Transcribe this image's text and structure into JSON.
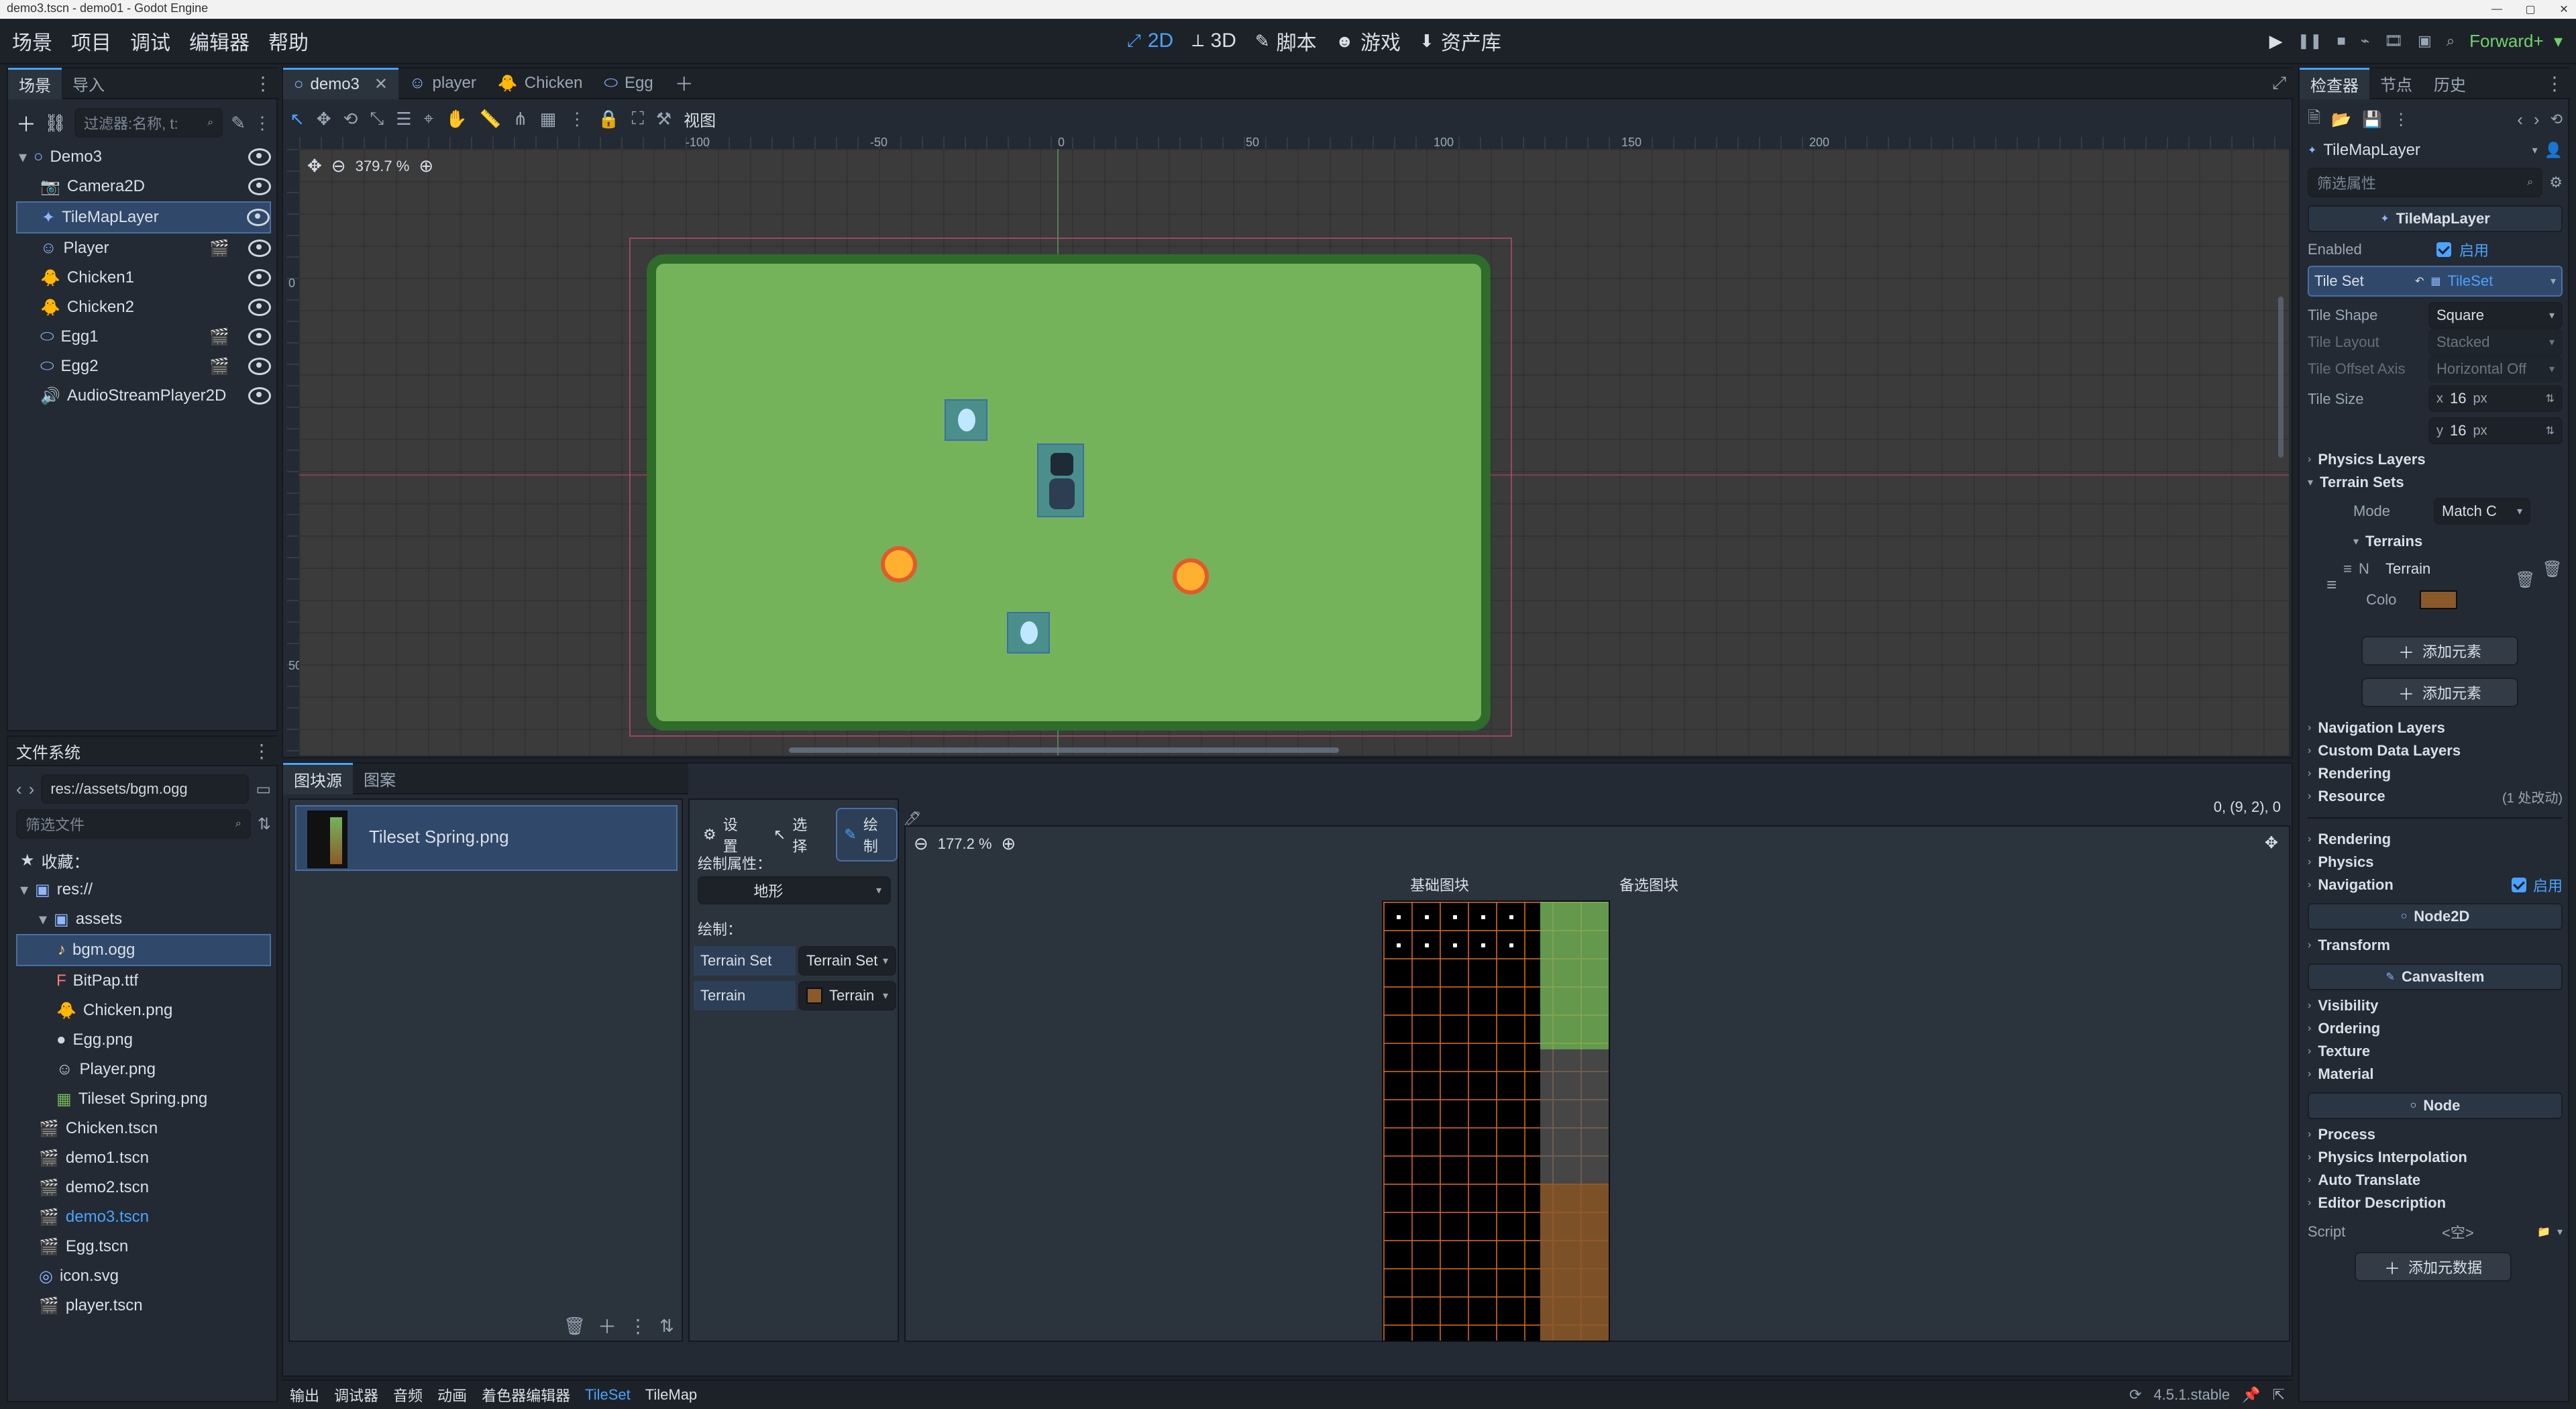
{
  "window": {
    "title": "demo3.tscn - demo01 - Godot Engine",
    "controls": [
      "minimize-icon",
      "maximize-icon",
      "close-icon"
    ]
  },
  "menubar": {
    "menus": [
      "场景",
      "项目",
      "调试",
      "编辑器",
      "帮助"
    ],
    "center_modes": [
      "2D",
      "3D",
      "脚本",
      "游戏",
      "资产库"
    ],
    "renderer_label": "Forward+"
  },
  "scene_dock": {
    "tabs": [
      "场景",
      "导入"
    ],
    "filter_placeholder": "过滤器:名称, t:",
    "nodes": [
      {
        "name": "Demo3",
        "indent": 0,
        "type_icon": "node2d-icon",
        "selected": false
      },
      {
        "name": "Camera2D",
        "indent": 1,
        "type_icon": "camera-icon",
        "selected": false
      },
      {
        "name": "TileMapLayer",
        "indent": 1,
        "type_icon": "tilemap-icon",
        "selected": true
      },
      {
        "name": "Player",
        "indent": 1,
        "type_icon": "player-icon",
        "selected": false
      },
      {
        "name": "Chicken1",
        "indent": 1,
        "type_icon": "chicken-icon",
        "selected": false
      },
      {
        "name": "Chicken2",
        "indent": 1,
        "type_icon": "chicken-icon",
        "selected": false
      },
      {
        "name": "Egg1",
        "indent": 1,
        "type_icon": "egg-icon",
        "selected": false
      },
      {
        "name": "Egg2",
        "indent": 1,
        "type_icon": "egg-icon",
        "selected": false
      },
      {
        "name": "AudioStreamPlayer2D",
        "indent": 1,
        "type_icon": "audio-icon",
        "selected": false
      }
    ]
  },
  "filesystem_dock": {
    "title": "文件系统",
    "path": "res://assets/bgm.ogg",
    "filter_placeholder": "筛选文件",
    "favorites_label": "收藏：",
    "items": [
      {
        "label": "res://",
        "indent": 0,
        "type": "folder"
      },
      {
        "label": "assets",
        "indent": 1,
        "type": "folder"
      },
      {
        "label": "bgm.ogg",
        "indent": 2,
        "type": "audio",
        "selected": true
      },
      {
        "label": "BitPap.ttf",
        "indent": 2,
        "type": "font"
      },
      {
        "label": "Chicken.png",
        "indent": 2,
        "type": "image"
      },
      {
        "label": "Egg.png",
        "indent": 2,
        "type": "image"
      },
      {
        "label": "Player.png",
        "indent": 2,
        "type": "image"
      },
      {
        "label": "Tileset Spring.png",
        "indent": 2,
        "type": "image"
      },
      {
        "label": "Chicken.tscn",
        "indent": 1,
        "type": "scene"
      },
      {
        "label": "demo1.tscn",
        "indent": 1,
        "type": "scene"
      },
      {
        "label": "demo2.tscn",
        "indent": 1,
        "type": "scene"
      },
      {
        "label": "demo3.tscn",
        "indent": 1,
        "type": "scene",
        "active": true
      },
      {
        "label": "Egg.tscn",
        "indent": 1,
        "type": "scene"
      },
      {
        "label": "icon.svg",
        "indent": 1,
        "type": "svg"
      },
      {
        "label": "player.tscn",
        "indent": 1,
        "type": "scene"
      }
    ]
  },
  "scene_tabs": {
    "tabs": [
      "demo3",
      "player",
      "Chicken",
      "Egg"
    ],
    "active_index": 0
  },
  "viewport": {
    "zoom_label": "379.7 %",
    "toolbar_view_label": "视图",
    "ruler_labels": [
      "-100",
      "-50",
      "0",
      "50",
      "100",
      "150",
      "200"
    ],
    "left_ruler_labels": [
      "0",
      "50"
    ]
  },
  "bottom_panel": {
    "tabs": [
      "图块源",
      "图案"
    ],
    "source_name": "Tileset Spring.png",
    "tools": [
      "设置",
      "选择",
      "绘制"
    ],
    "paint_props_label": "绘制属性：",
    "paint_mode_value": "地形",
    "paint_label": "绘制：",
    "terrain_set_label": "Terrain Set",
    "terrain_set_value": "Terrain Set",
    "terrain_label": "Terrain",
    "terrain_value": "Terrain",
    "atlas_zoom": "177.2 %",
    "atlas_headers": [
      "基础图块",
      "备选图块"
    ],
    "coords": "0, (9, 2), 0"
  },
  "bottom_tabs": {
    "items": [
      "输出",
      "调试器",
      "音频",
      "动画",
      "着色器编辑器",
      "TileSet",
      "TileMap"
    ],
    "active": "TileSet",
    "version": "4.5.1.stable"
  },
  "inspector": {
    "tabs": [
      "检查器",
      "节点",
      "历史"
    ],
    "object_name": "TileMapLayer",
    "filter_placeholder": "筛选属性",
    "section_title": "TileMapLayer",
    "enabled_label": "Enabled",
    "enabled_value": "启用",
    "tileset_label": "Tile Set",
    "tileset_value": "TileSet",
    "props": [
      {
        "label": "Tile Shape",
        "value": "Square",
        "disabled": false
      },
      {
        "label": "Tile Layout",
        "value": "Stacked",
        "disabled": true
      },
      {
        "label": "Tile Offset Axis",
        "value": "Horizontal Off",
        "disabled": true
      }
    ],
    "tile_size": {
      "label": "Tile Size",
      "x": "16",
      "y": "16",
      "unit": "px"
    },
    "subsections": [
      {
        "label": "Physics Layers"
      },
      {
        "label": "Terrain Sets",
        "expanded": true
      }
    ],
    "terrain_sets": {
      "mode_label": "Mode",
      "mode_value": "Match C",
      "terrains_label": "Terrains",
      "terrain_name_label": "N",
      "terrain_name_value": "Terrain",
      "terrain_color_label": "Colo",
      "add_element_inner": "添加元素",
      "add_element_outer": "添加元素"
    },
    "more_sections": [
      "Navigation Layers",
      "Custom Data Layers",
      "Rendering"
    ],
    "resource_row": {
      "label": "Resource",
      "value": "(1 处改动)"
    },
    "node_sections": [
      "Rendering",
      "Physics",
      "Navigation"
    ],
    "navigation_enabled": "启用",
    "headers": [
      {
        "label": "Node2D"
      },
      {
        "label": "CanvasItem"
      },
      {
        "label": "Node"
      }
    ],
    "node2d_sections": [
      "Transform"
    ],
    "canvasitem_sections": [
      "Visibility",
      "Ordering",
      "Texture",
      "Material"
    ],
    "node_sections2": [
      "Process",
      "Physics Interpolation",
      "Auto Translate",
      "Editor Description"
    ],
    "script_label": "Script",
    "script_value": "<空>",
    "add_metadata": "添加元数据"
  },
  "colors": {
    "accent": "#4aa3ff",
    "selection": "#30486a",
    "tilemap_green": "#75b35a",
    "terrain_color": "#8b5a2b"
  }
}
